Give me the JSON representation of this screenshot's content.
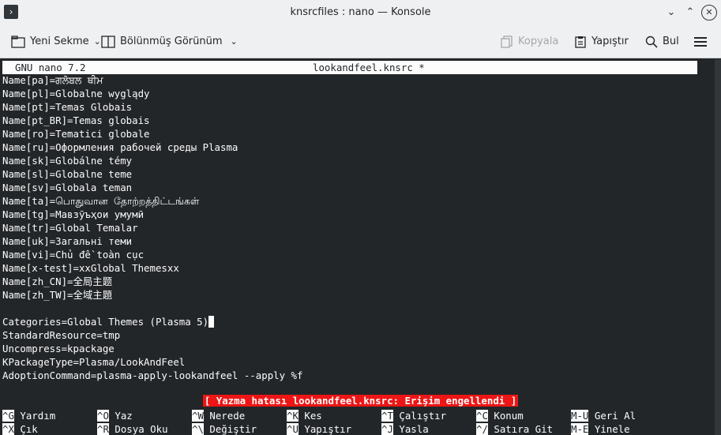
{
  "window": {
    "title": "knsrcfiles : nano — Konsole",
    "app_icon": "terminal-icon",
    "minimize": "⌄",
    "maximize": "⌃",
    "close": "✕"
  },
  "toolbar": {
    "new_tab": "Yeni Sekme",
    "split_view": "Bölünmüş Görünüm",
    "copy": "Kopyala",
    "paste": "Yapıştır",
    "find": "Bul"
  },
  "nano": {
    "version": "GNU nano 7.2",
    "filename": "lookandfeel.knsrc *",
    "lines": [
      "Name[pa]=ਗਲੋਬਲ ਥੀਮ",
      "Name[pl]=Globalne wyglądy",
      "Name[pt]=Temas Globais",
      "Name[pt_BR]=Temas globais",
      "Name[ro]=Tematici globale",
      "Name[ru]=Оформления рабочей среды Plasma",
      "Name[sk]=Globálne témy",
      "Name[sl]=Globalne teme",
      "Name[sv]=Globala teman",
      "Name[ta]=பொதுவான தோற்றத்திட்டங்கள்",
      "Name[tg]=Мавзӯъҳои умумӣ",
      "Name[tr]=Global Temalar",
      "Name[uk]=Загальні теми",
      "Name[vi]=Chủ đề toàn cục",
      "Name[x-test]=xxGlobal Themesxx",
      "Name[zh_CN]=全局主题",
      "Name[zh_TW]=全域主題",
      "",
      "Categories=Global Themes (Plasma 5)",
      "StandardResource=tmp",
      "Uncompress=kpackage",
      "KPackageType=Plasma/LookAndFeel",
      "AdoptionCommand=plasma-apply-lookandfeel --apply %f"
    ],
    "status_message": "[ Yazma hatası lookandfeel.knsrc: Erişim engellendi ]",
    "shortcuts_row1": [
      {
        "key": "^G",
        "label": "Yardım"
      },
      {
        "key": "^O",
        "label": "Yaz"
      },
      {
        "key": "^W",
        "label": "Nerede"
      },
      {
        "key": "^K",
        "label": "Kes"
      },
      {
        "key": "^T",
        "label": "Çalıştır"
      },
      {
        "key": "^C",
        "label": "Konum"
      },
      {
        "key": "M-U",
        "label": "Geri Al"
      }
    ],
    "shortcuts_row2": [
      {
        "key": "^X",
        "label": "Çık"
      },
      {
        "key": "^R",
        "label": "Dosya Oku"
      },
      {
        "key": "^\\",
        "label": "Değiştir"
      },
      {
        "key": "^U",
        "label": "Yapıştır"
      },
      {
        "key": "^J",
        "label": "Yasla"
      },
      {
        "key": "^/",
        "label": "Satıra Git"
      },
      {
        "key": "M-E",
        "label": "Yinele"
      }
    ]
  },
  "colors": {
    "terminal_bg": "#232629",
    "terminal_fg": "#fcfcfc",
    "status_bg": "#ed1515",
    "chrome_bg": "#eff0f1"
  }
}
